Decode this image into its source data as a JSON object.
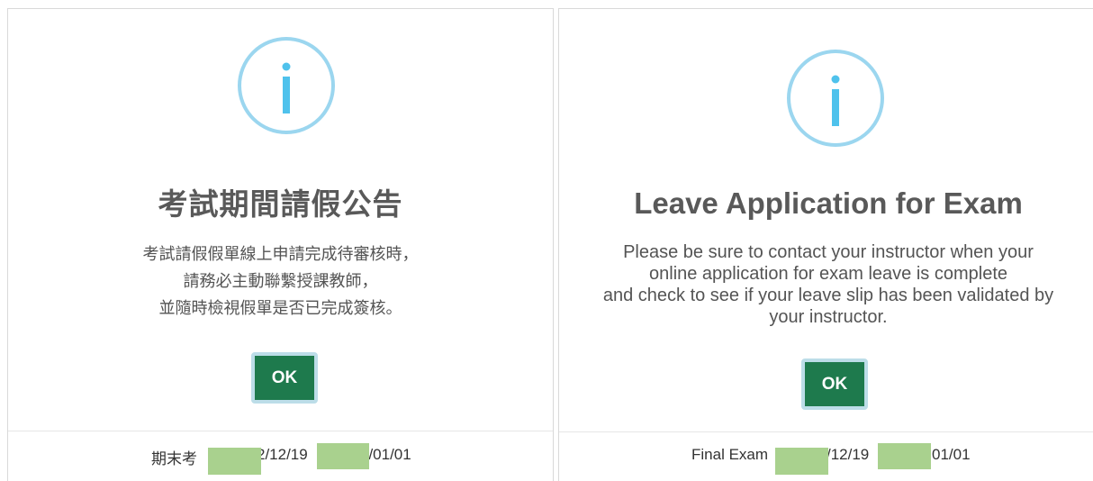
{
  "dialogs": [
    {
      "language": "zh-TW",
      "title": "考試期間請假公告",
      "message_lines": [
        "考試請假假單線上申請完成待審核時，",
        "請務必主動聯繫授課教師，",
        "並隨時檢視假單是否已完成簽核。"
      ],
      "ok_label": "OK",
      "footer": {
        "prefix": "期末考",
        "date_fragment_1": "2/12/19",
        "date_fragment_2": "3/01/01"
      },
      "icon": "info-icon"
    },
    {
      "language": "en",
      "title": "Leave Application for Exam",
      "message_lines": [
        "Please be sure to contact your instructor when your",
        "online application for exam leave is complete",
        "and check to see if your leave slip has been validated by",
        "your instructor."
      ],
      "ok_label": "OK",
      "footer": {
        "prefix": "Final Exam",
        "date_fragment_1": "/12/19",
        "date_fragment_2": "01/01"
      },
      "icon": "info-icon"
    }
  ],
  "colors": {
    "ok_button": "#1e7a4d",
    "ok_button_border": "#bcdde8",
    "info_icon": "#9bd6ef",
    "info_glyph": "#4fc2ec",
    "redaction": "#a9d18e",
    "title_text": "#595959",
    "body_text": "#545454"
  }
}
